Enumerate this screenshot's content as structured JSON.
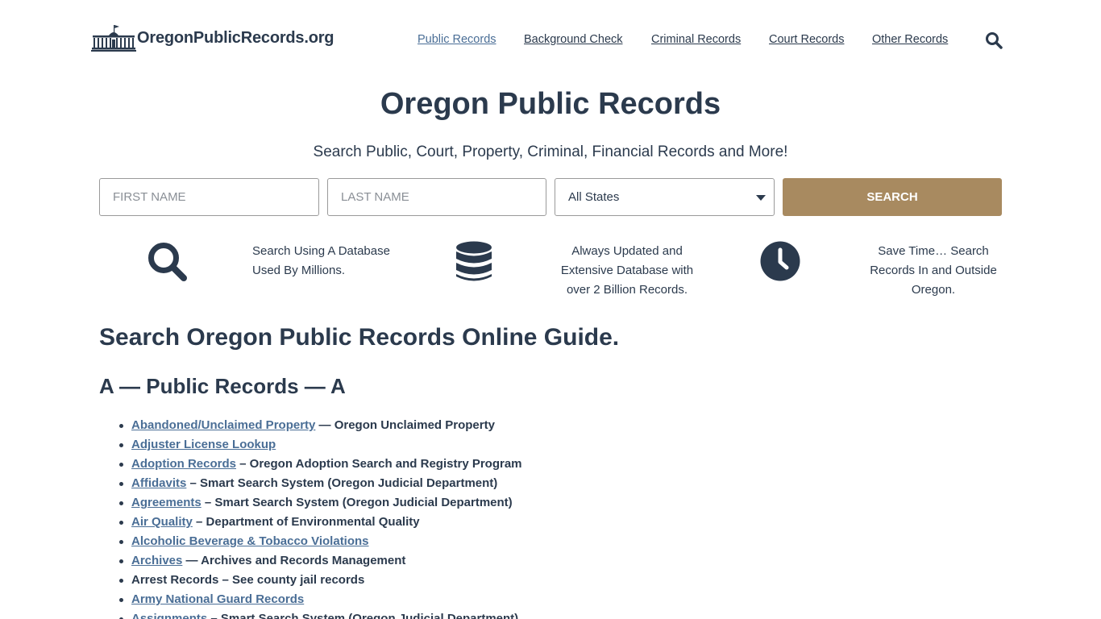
{
  "site": {
    "logo_text": "OregonPublicRecords.org"
  },
  "nav": {
    "items": [
      {
        "label": "Public Records"
      },
      {
        "label": "Background Check"
      },
      {
        "label": "Criminal Records"
      },
      {
        "label": "Court Records"
      },
      {
        "label": "Other Records"
      }
    ],
    "search_icon": "search-icon"
  },
  "hero": {
    "title": "Oregon Public Records",
    "subtitle": "Search Public, Court, Property, Criminal, Financial Records and More!"
  },
  "form": {
    "first_name_placeholder": "FIRST NAME",
    "last_name_placeholder": "LAST NAME",
    "state_selected": "All States",
    "search_label": "SEARCH"
  },
  "features": [
    {
      "icon": "magnifier-icon",
      "line1": "Search Using A Database",
      "line2": "Used By Millions."
    },
    {
      "icon": "database-icon",
      "line1": "Always Updated and",
      "line2": "Extensive Database with",
      "line3": "over 2 Billion Records."
    },
    {
      "icon": "clock-icon",
      "line1": "Save Time… Search",
      "line2": "Records In and Outside",
      "line3": "Oregon."
    }
  ],
  "guide": {
    "title": "Search Oregon Public Records Online Guide.",
    "section_title": "A — Public Records — A",
    "items": [
      {
        "link": "Abandoned/Unclaimed Property",
        "rest": " — Oregon Unclaimed Property"
      },
      {
        "link": "Adjuster License Lookup",
        "rest": ""
      },
      {
        "link": "Adoption Records",
        "rest": " – Oregon Adoption Search and Registry Program"
      },
      {
        "link": "Affidavits",
        "rest": " – Smart Search System (Oregon Judicial Department)"
      },
      {
        "link": "Agreements",
        "rest": " – Smart Search System (Oregon Judicial Department)"
      },
      {
        "link": "Air Quality",
        "rest": " – Department of Environmental Quality"
      },
      {
        "link": "Alcoholic Beverage & Tobacco Violations",
        "rest": ""
      },
      {
        "link": "Archives",
        "rest": " — Archives and Records Management"
      },
      {
        "text": "Arrest Records – See county jail records"
      },
      {
        "link": "Army National Guard Records",
        "rest": ""
      },
      {
        "link": "Assignments",
        "rest": " – Smart Search System (Oregon Judicial Department)"
      }
    ]
  },
  "colors": {
    "text": "#2b3a4d",
    "link": "#4a6e96",
    "button": "#a88a60"
  }
}
